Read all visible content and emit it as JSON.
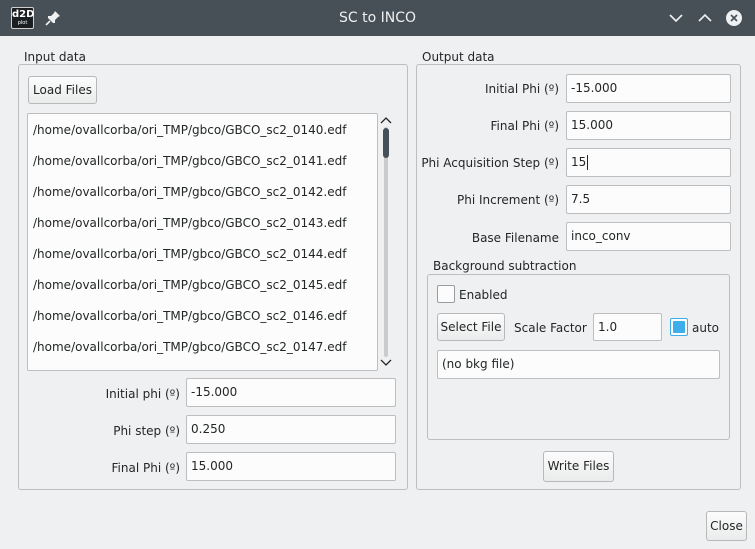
{
  "window": {
    "title": "SC to INCO",
    "logo_text": "d2D",
    "logo_subtext": "plot"
  },
  "input": {
    "group_title": "Input data",
    "load_button": "Load Files",
    "files": [
      "/home/ovallcorba/ori_TMP/gbco/GBCO_sc2_0140.edf",
      "/home/ovallcorba/ori_TMP/gbco/GBCO_sc2_0141.edf",
      "/home/ovallcorba/ori_TMP/gbco/GBCO_sc2_0142.edf",
      "/home/ovallcorba/ori_TMP/gbco/GBCO_sc2_0143.edf",
      "/home/ovallcorba/ori_TMP/gbco/GBCO_sc2_0144.edf",
      "/home/ovallcorba/ori_TMP/gbco/GBCO_sc2_0145.edf",
      "/home/ovallcorba/ori_TMP/gbco/GBCO_sc2_0146.edf",
      "/home/ovallcorba/ori_TMP/gbco/GBCO_sc2_0147.edf"
    ],
    "initial_phi_label": "Initial phi (º)",
    "initial_phi_value": "-15.000",
    "phi_step_label": "Phi step (º)",
    "phi_step_value": "0.250",
    "final_phi_label": "Final Phi (º)",
    "final_phi_value": "15.000"
  },
  "output": {
    "group_title": "Output data",
    "initial_phi_label": "Initial Phi (º)",
    "initial_phi_value": "-15.000",
    "final_phi_label": "Final Phi (º)",
    "final_phi_value": "15.000",
    "acq_step_label": "Phi Acquisition Step (º)",
    "acq_step_value": "15",
    "increment_label": "Phi Increment (º)",
    "increment_value": "7.5",
    "base_filename_label": "Base Filename",
    "base_filename_value": "inco_conv",
    "background": {
      "group_title": "Background subtraction",
      "enabled_label": "Enabled",
      "enabled_checked": false,
      "select_button": "Select File",
      "scale_label": "Scale Factor",
      "scale_value": "1.0",
      "auto_label": "auto",
      "auto_checked": true,
      "file_value": "(no bkg file)"
    },
    "write_button": "Write Files"
  },
  "close_button": "Close",
  "colors": {
    "titlebar": "#475057",
    "accent": "#3daee9",
    "window_bg": "#eff0f1"
  }
}
